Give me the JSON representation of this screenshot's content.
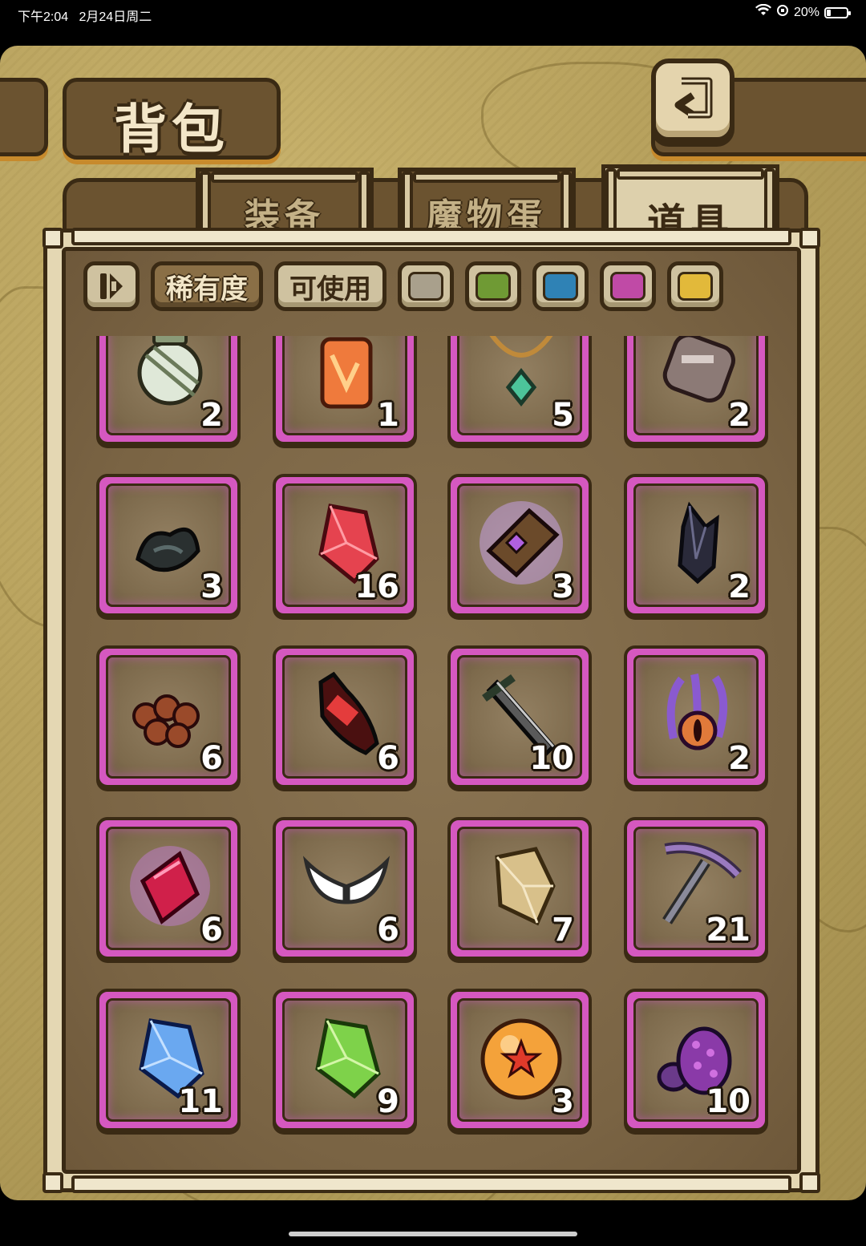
{
  "status": {
    "time": "下午2:04",
    "date": "2月24日周二",
    "battery": "20%"
  },
  "header": {
    "title": "背包"
  },
  "tabs": [
    {
      "label": "装备"
    },
    {
      "label": "魔物蛋"
    },
    {
      "label": "道具",
      "active": true
    }
  ],
  "filters": {
    "rarity": "稀有度",
    "usable": "可使用",
    "colors": [
      "#a9a08c",
      "#6f9a34",
      "#2f82b5",
      "#c04aa6",
      "#e2b93a"
    ]
  },
  "items": [
    {
      "icon": "lantern-icon",
      "count": "2"
    },
    {
      "icon": "fire-crystal-icon",
      "count": "1"
    },
    {
      "icon": "jade-necklace-icon",
      "count": "5"
    },
    {
      "icon": "gauntlet-icon",
      "count": "2"
    },
    {
      "icon": "black-ore-icon",
      "count": "3"
    },
    {
      "icon": "red-gem-icon",
      "count": "16"
    },
    {
      "icon": "spell-book-icon",
      "count": "3"
    },
    {
      "icon": "dark-crystal-icon",
      "count": "2"
    },
    {
      "icon": "seeds-icon",
      "count": "6"
    },
    {
      "icon": "cola-bottle-icon",
      "count": "6"
    },
    {
      "icon": "broken-sword-icon",
      "count": "10"
    },
    {
      "icon": "tentacle-eye-icon",
      "count": "2"
    },
    {
      "icon": "magic-crystal-icon",
      "count": "6"
    },
    {
      "icon": "angel-wings-icon",
      "count": "6"
    },
    {
      "icon": "tan-gem-icon",
      "count": "7"
    },
    {
      "icon": "pickaxe-icon",
      "count": "21"
    },
    {
      "icon": "blue-gem-icon",
      "count": "11"
    },
    {
      "icon": "green-gem-icon",
      "count": "9"
    },
    {
      "icon": "star-orb-icon",
      "count": "3"
    },
    {
      "icon": "purple-egg-icon",
      "count": "10"
    }
  ]
}
